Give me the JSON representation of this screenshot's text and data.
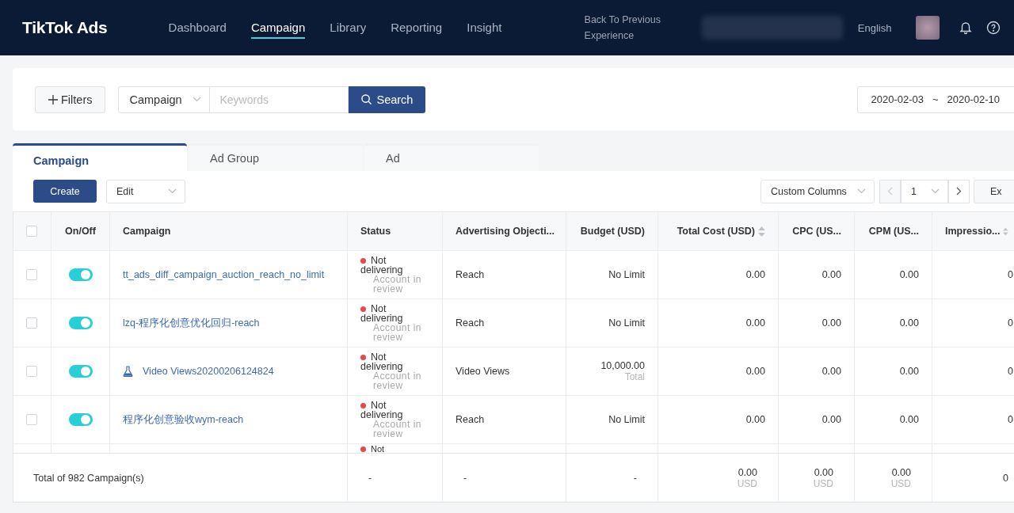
{
  "header": {
    "logo": "TikTok Ads",
    "nav": [
      {
        "label": "Dashboard",
        "selected": false
      },
      {
        "label": "Campaign",
        "selected": true
      },
      {
        "label": "Library",
        "selected": false
      },
      {
        "label": "Reporting",
        "selected": false
      },
      {
        "label": "Insight",
        "selected": false
      }
    ],
    "back_link": "Back To Previous Experience",
    "language": "English"
  },
  "filters": {
    "filters_button": "Filters",
    "scope": "Campaign",
    "keywords_placeholder": "Keywords",
    "search_button": "Search",
    "date_from": "2020-02-03",
    "date_separator": "~",
    "date_to": "2020-02-10"
  },
  "tabs": [
    {
      "label": "Campaign",
      "selected": true
    },
    {
      "label": "Ad Group",
      "selected": false
    },
    {
      "label": "Ad",
      "selected": false
    }
  ],
  "toolbar": {
    "create": "Create",
    "edit": "Edit",
    "custom_columns": "Custom Columns",
    "page": "1",
    "export": "Ex"
  },
  "table": {
    "select_all_checked": false,
    "columns": [
      {
        "kind": "check"
      },
      {
        "kind": "toggle",
        "label": "On/Off"
      },
      {
        "kind": "text",
        "label": "Campaign"
      },
      {
        "kind": "text",
        "label": "Status"
      },
      {
        "kind": "text",
        "label": "Advertising Objecti..."
      },
      {
        "kind": "number",
        "label": "Budget (USD)",
        "sortable": false
      },
      {
        "kind": "number",
        "label": "Total Cost (USD)",
        "sortable": true
      },
      {
        "kind": "number",
        "label": "CPC (US...",
        "sortable": false
      },
      {
        "kind": "number",
        "label": "CPM (US...",
        "sortable": false
      },
      {
        "kind": "number",
        "label": "Impressio...",
        "sortable": true
      }
    ],
    "rows": [
      {
        "selected": false,
        "on": true,
        "campaign": "tt_ads_diff_campaign_auction_reach_no_limit",
        "experiment": false,
        "status": "Not delivering",
        "status_detail": "Account in review",
        "color": "#e5484d",
        "objective": "Reach",
        "budget": "No Limit",
        "total_cost": "0.00",
        "cpc": "0.00",
        "cpm": "0.00",
        "impressions": "0"
      },
      {
        "selected": false,
        "on": true,
        "campaign": "lzq-程序化创意优化回归-reach",
        "experiment": false,
        "status": "Not delivering",
        "status_detail": "Account in review",
        "color": "#e5484d",
        "objective": "Reach",
        "budget": "No Limit",
        "total_cost": "0.00",
        "cpc": "0.00",
        "cpm": "0.00",
        "impressions": "0"
      },
      {
        "selected": false,
        "on": true,
        "campaign": "Video Views20200206124824",
        "experiment": true,
        "status": "Not delivering",
        "status_detail": "Account in review",
        "color": "#e5484d",
        "objective": "Video Views",
        "budget": "10,000.00",
        "budget_note": "Total",
        "total_cost": "0.00",
        "cpc": "0.00",
        "cpm": "0.00",
        "impressions": "0"
      },
      {
        "selected": false,
        "on": true,
        "campaign": "程序化创意验收wym-reach",
        "experiment": false,
        "status": "Not delivering",
        "status_detail": "Account in review",
        "color": "#e5484d",
        "objective": "Reach",
        "budget": "No Limit",
        "total_cost": "0.00",
        "cpc": "0.00",
        "cpm": "0.00",
        "impressions": "0"
      }
    ],
    "partial_row": {
      "status": "Not",
      "color": "#e5484d"
    },
    "footer": {
      "total": "Total of 982 Campaign(s)",
      "status": "-",
      "objective": "-",
      "budget": "-",
      "total_cost": "0.00",
      "total_cost_unit": "USD",
      "cpc": "0.00",
      "cpc_unit": "USD",
      "cpm": "0.00",
      "cpm_unit": "USD",
      "impressions": "0"
    }
  }
}
